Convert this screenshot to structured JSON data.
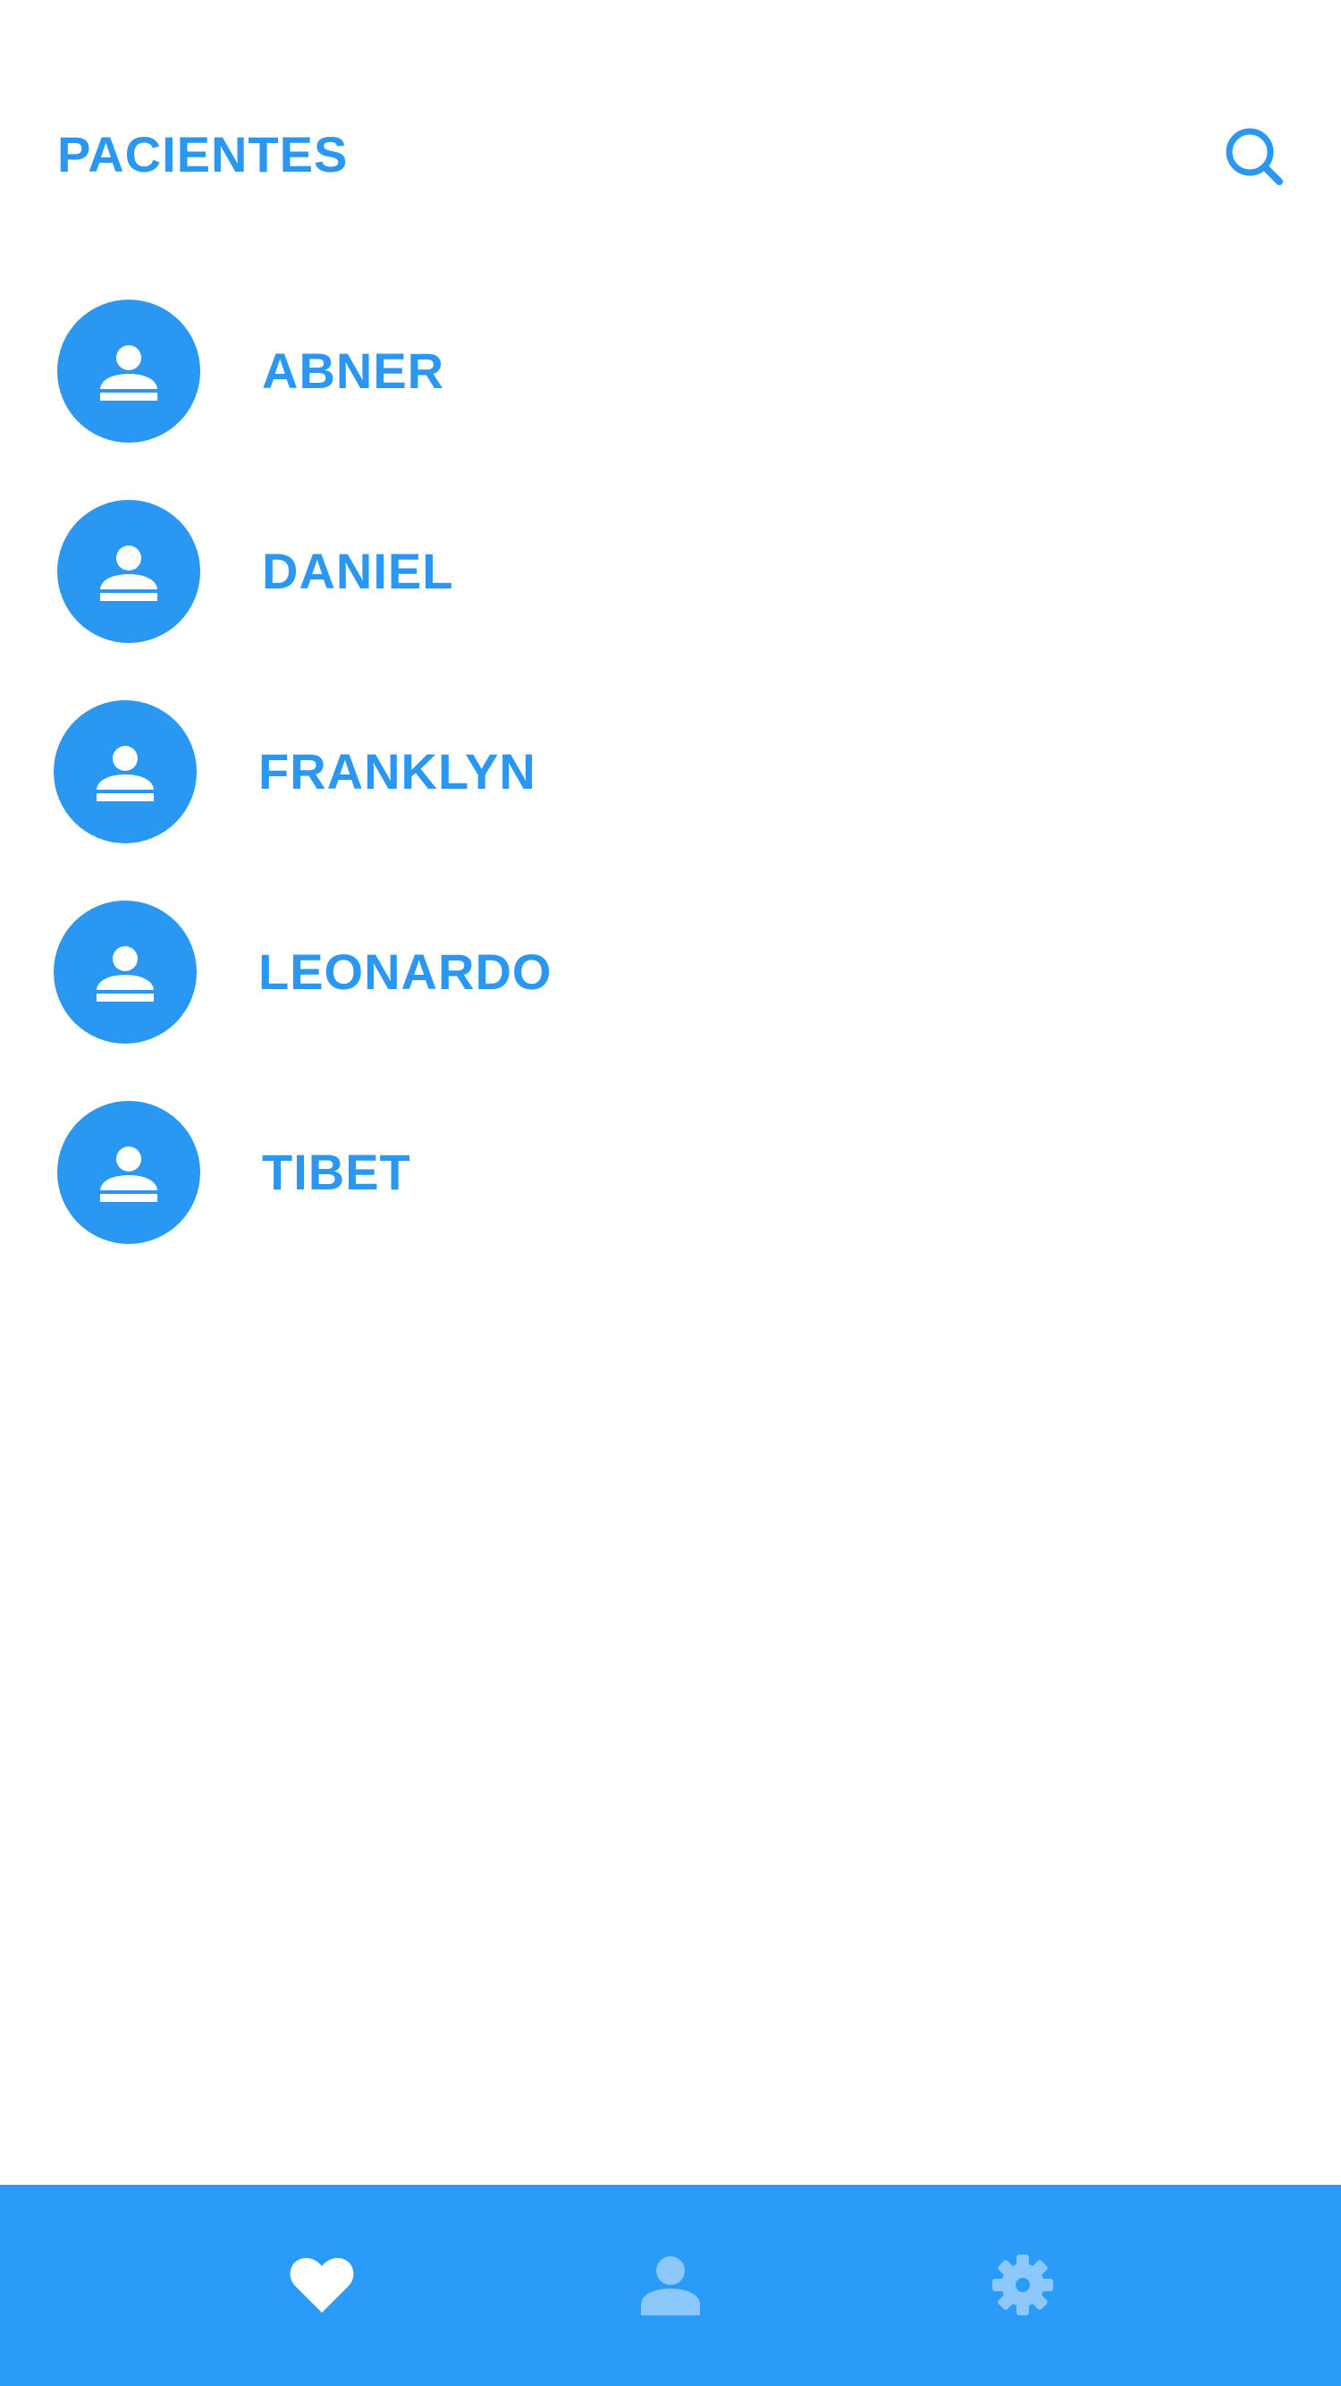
{
  "header": {
    "title": "PACIENTES",
    "search_icon": "search-icon"
  },
  "patients": [
    {
      "name": "ABNER",
      "icon": "person-icon"
    },
    {
      "name": "DANIEL",
      "icon": "person-icon"
    },
    {
      "name": "FRANKLYN",
      "icon": "person-icon"
    },
    {
      "name": "LEONARDO",
      "icon": "person-icon"
    },
    {
      "name": "TIBET",
      "icon": "person-icon"
    }
  ],
  "bottom_nav": {
    "items": [
      {
        "icon": "heart-icon",
        "active": true
      },
      {
        "icon": "person-icon",
        "active": false
      },
      {
        "icon": "gear-icon",
        "active": false
      }
    ]
  },
  "colors": {
    "accent": "#2a97f3",
    "nav_background": "#2a9bf9",
    "nav_active_icon": "#ffffff",
    "nav_inactive_icon": "#8cc8fb",
    "background": "#ffffff"
  }
}
